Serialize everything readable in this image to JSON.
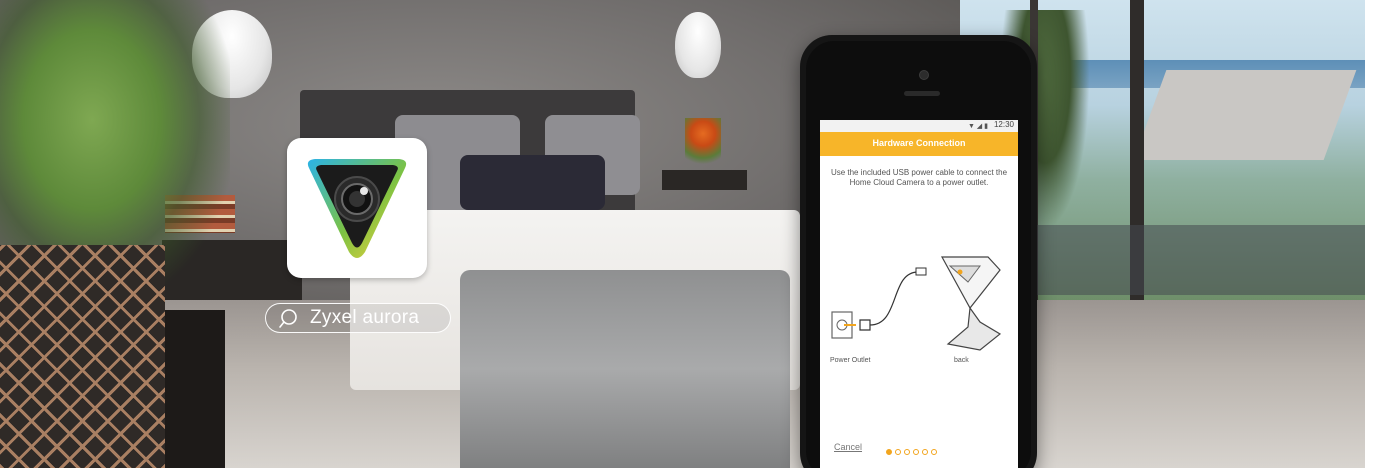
{
  "search": {
    "query": "Zyxel aurora"
  },
  "app_icon": {
    "name": "zyxel-aurora-app-icon",
    "colors": {
      "tile": "#ffffff",
      "shape": "#1b1b1b",
      "gradient": [
        "#2bb3e7",
        "#7cc243",
        "#f7d23a"
      ]
    }
  },
  "phone": {
    "status_time": "12:30",
    "status_icons": "▼ ◢ ▮",
    "header_title": "Hardware Connection",
    "header_color": "#f7b529",
    "instructions": "Use the included USB power cable to connect the Home Cloud Camera to a power outlet.",
    "diagram": {
      "outlet_label": "Power Outlet",
      "camera_label": "back"
    },
    "footer": {
      "cancel_label": "Cancel",
      "page_count": 6,
      "active_page": 1
    }
  }
}
